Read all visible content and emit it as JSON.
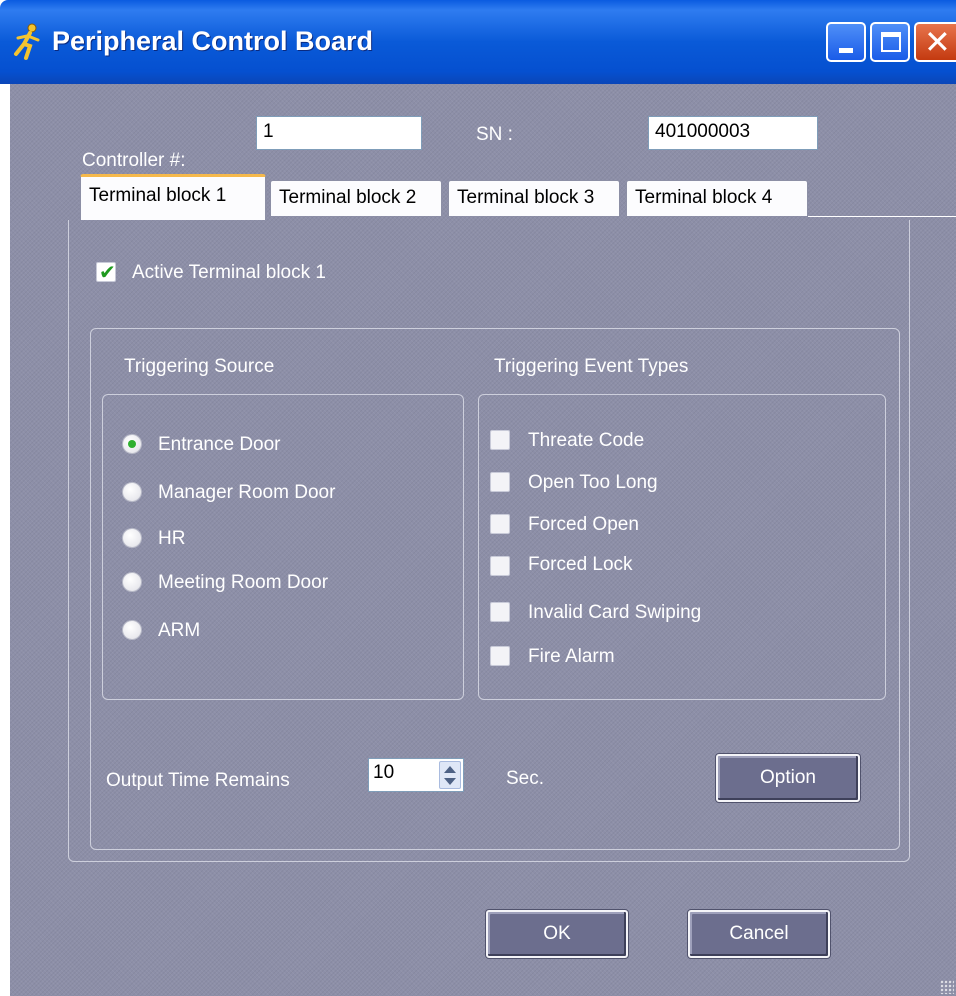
{
  "window": {
    "title": "Peripheral Control Board",
    "title_icon": "running-man-icon"
  },
  "header": {
    "controller_label": "Controller #:",
    "controller_value": "1",
    "sn_label": "SN :",
    "sn_value": "401000003"
  },
  "tabs": [
    {
      "label": "Terminal block 1",
      "active": true
    },
    {
      "label": "Terminal block 2",
      "active": false
    },
    {
      "label": "Terminal block 3",
      "active": false
    },
    {
      "label": "Terminal block 4",
      "active": false
    }
  ],
  "panel": {
    "active_checkbox_label": "Active Terminal block 1",
    "active_checked": true,
    "triggering_source_label": "Triggering Source",
    "triggering_event_types_label": "Triggering Event Types",
    "sources": [
      {
        "label": "Entrance Door",
        "selected": true
      },
      {
        "label": "Manager Room Door",
        "selected": false
      },
      {
        "label": "HR",
        "selected": false
      },
      {
        "label": "Meeting Room Door",
        "selected": false
      },
      {
        "label": "ARM",
        "selected": false
      }
    ],
    "events": [
      {
        "label": "Threate Code",
        "checked": false
      },
      {
        "label": "Open Too Long",
        "checked": false
      },
      {
        "label": "Forced Open",
        "checked": false
      },
      {
        "label": "Forced Lock",
        "checked": false
      },
      {
        "label": "Invalid Card Swiping",
        "checked": false
      },
      {
        "label": "Fire Alarm",
        "checked": false
      }
    ],
    "output_time_label": "Output Time Remains",
    "output_time_value": "10",
    "output_time_unit": "Sec.",
    "option_button": "Option"
  },
  "footer": {
    "ok_button": "OK",
    "cancel_button": "Cancel"
  },
  "colors": {
    "titlebar": "#0a5ad8",
    "client_bg": "#8d8fa8",
    "check_green": "#1f9a1f",
    "tab_accent": "#f6b94b"
  }
}
